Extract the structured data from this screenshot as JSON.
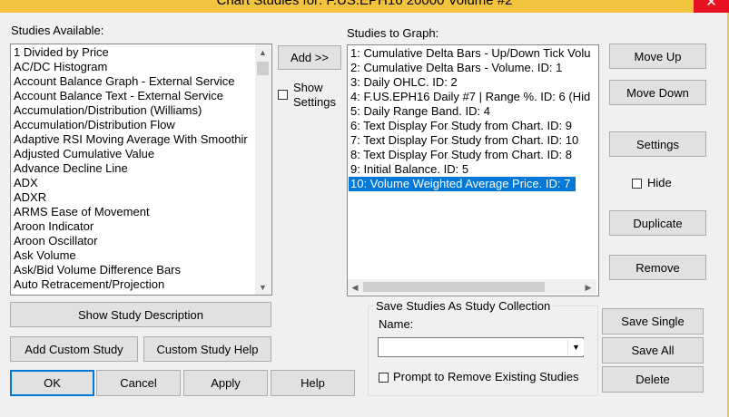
{
  "window": {
    "title": "Chart Studies for: F.US.EPH16  20000 Volume  #2",
    "close_glyph": "✕"
  },
  "available": {
    "label": "Studies Available:",
    "items": [
      "1 Divided by Price",
      "AC/DC Histogram",
      "Account Balance Graph - External Service",
      "Account Balance Text - External Service",
      "Accumulation/Distribution (Williams)",
      "Accumulation/Distribution Flow",
      "Adaptive RSI Moving Average With Smoothir",
      "Adjusted Cumulative Value",
      "Advance Decline Line",
      "ADX",
      "ADXR",
      "ARMS Ease of Movement",
      "Aroon Indicator",
      "Aroon Oscillator",
      "Ask Volume",
      "Ask/Bid Volume Difference Bars",
      "Auto Retracement/Projection"
    ]
  },
  "middle": {
    "add_label": "Add >>",
    "show_settings_line1": "Show",
    "show_settings_line2": "Settings"
  },
  "graph": {
    "label": "Studies to Graph:",
    "items": [
      "1: Cumulative Delta Bars - Up/Down Tick Volu",
      "2: Cumulative Delta Bars - Volume. ID: 1",
      "3: Daily OHLC. ID: 2",
      "4: F.US.EPH16  Daily  #7 | Range %. ID: 6 (Hid",
      "5: Daily Range Band. ID: 4",
      "6: Text Display For Study from Chart. ID: 9",
      "7: Text Display For Study from Chart. ID: 10",
      "8: Text Display For Study from Chart. ID: 8",
      "9: Initial Balance. ID: 5",
      "10: Volume Weighted Average Price. ID: 7"
    ],
    "selected_index": 9
  },
  "right_buttons": {
    "move_up": "Move Up",
    "move_down": "Move Down",
    "settings": "Settings",
    "hide": "Hide",
    "duplicate": "Duplicate",
    "remove": "Remove"
  },
  "bottom_buttons": {
    "show_description": "Show Study Description",
    "add_custom": "Add Custom Study",
    "custom_help": "Custom Study Help",
    "ok": "OK",
    "cancel": "Cancel",
    "apply": "Apply",
    "help": "Help"
  },
  "collection": {
    "group_title": "Save Studies As Study Collection",
    "name_label": "Name:",
    "name_value": "",
    "prompt_label": "Prompt to Remove Existing Studies",
    "save_single": "Save Single",
    "save_all": "Save All",
    "delete": "Delete"
  }
}
